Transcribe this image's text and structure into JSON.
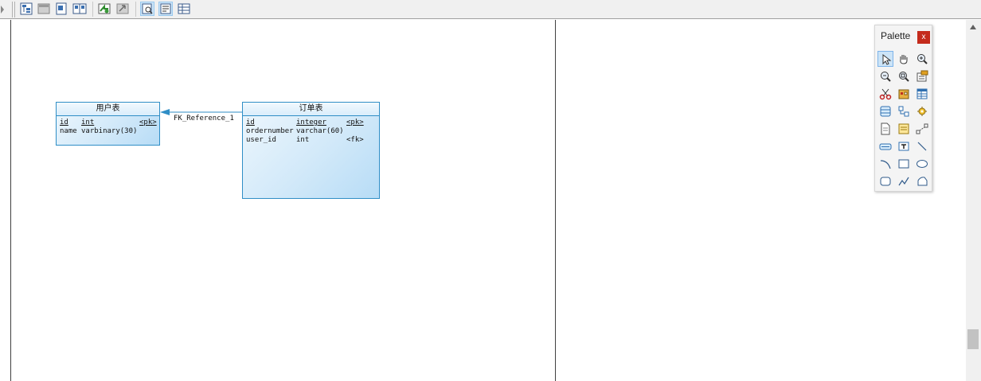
{
  "toolbar": {
    "buttons": [
      {
        "name": "tree-icon"
      },
      {
        "name": "grey-panel-icon"
      },
      {
        "name": "page-icon"
      },
      {
        "name": "two-pages-icon"
      },
      {
        "name": "green-arrows-icon"
      },
      {
        "name": "grey-arrow-icon"
      },
      {
        "name": "preview-icon",
        "active": true
      },
      {
        "name": "text-lines-icon",
        "active": true
      },
      {
        "name": "list-table-icon"
      }
    ]
  },
  "diagram": {
    "tables": [
      {
        "title": "用户表",
        "columns": [
          {
            "name": "id",
            "type": "int",
            "key": "<pk>",
            "underline": true
          },
          {
            "name": "name",
            "type": "varbinary(30)",
            "key": "",
            "underline": false
          }
        ]
      },
      {
        "title": "订单表",
        "columns": [
          {
            "name": "id",
            "type": "integer",
            "key": "<pk>",
            "underline": true
          },
          {
            "name": "ordernumber",
            "type": "varchar(60)",
            "key": "",
            "underline": false
          },
          {
            "name": "user_id",
            "type": "int",
            "key": "<fk>",
            "underline": false
          }
        ]
      }
    ],
    "reference": {
      "label": "FK_Reference_1"
    },
    "colors": {
      "entity_border": "#2f8ec6",
      "entity_fill": "#cfe8fa",
      "link": "#2f8ec6"
    }
  },
  "palette": {
    "title": "Palette",
    "close_label": "x",
    "tools": [
      "pointer-icon",
      "hand-icon",
      "zoom-in-icon",
      "zoom-out-icon",
      "zoom-fit-icon",
      "properties-icon",
      "cut-icon",
      "package-icon",
      "table-icon",
      "view-icon",
      "reference-icon",
      "procedure-icon",
      "file-icon",
      "note-icon",
      "link-icon",
      "domain-icon",
      "text-icon",
      "line-icon",
      "arc-icon",
      "rectangle-icon",
      "ellipse-icon",
      "rounded-rectangle-icon",
      "polyline-icon",
      "polygon-icon"
    ]
  }
}
